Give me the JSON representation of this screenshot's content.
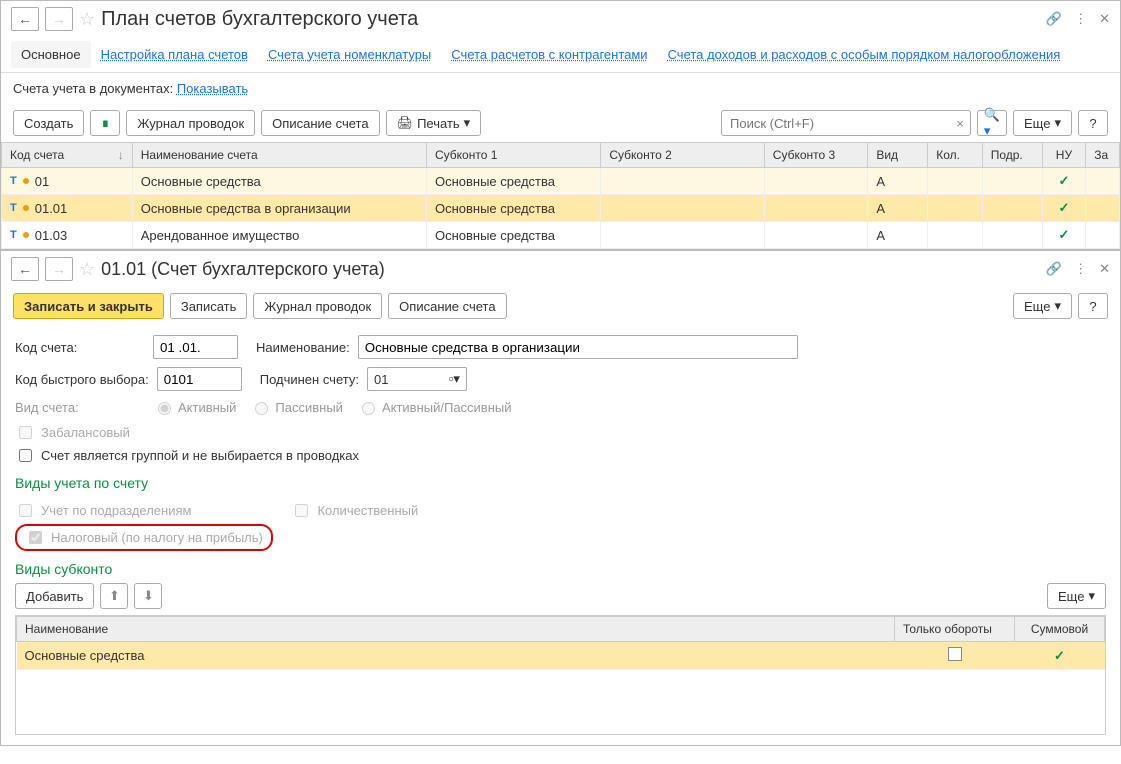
{
  "top": {
    "title": "План счетов бухгалтерского учета",
    "tabs": [
      "Основное",
      "Настройка плана счетов",
      "Счета учета номенклатуры",
      "Счета расчетов с контрагентами",
      "Счета доходов и расходов с особым порядком налогообложения"
    ],
    "subline_label": "Счета учета в документах:",
    "subline_link": "Показывать",
    "toolbar": {
      "create": "Создать",
      "journal": "Журнал проводок",
      "desc": "Описание счета",
      "print": "Печать",
      "more": "Еще",
      "help": "?",
      "search_placeholder": "Поиск (Ctrl+F)"
    },
    "cols": {
      "code": "Код счета",
      "name": "Наименование счета",
      "sub1": "Субконто 1",
      "sub2": "Субконто 2",
      "sub3": "Субконто 3",
      "vid": "Вид",
      "kol": "Кол.",
      "podr": "Подр.",
      "nu": "НУ",
      "za": "За"
    },
    "rows": [
      {
        "code": "01",
        "name": "Основные средства",
        "sub1": "Основные средства",
        "vid": "А",
        "nu": true
      },
      {
        "code": "01.01",
        "name": "Основные средства в организации",
        "sub1": "Основные средства",
        "vid": "А",
        "nu": true
      },
      {
        "code": "01.03",
        "name": "Арендованное имущество",
        "sub1": "Основные средства",
        "vid": "А",
        "nu": true
      }
    ]
  },
  "detail": {
    "title": "01.01 (Счет бухгалтерского учета)",
    "toolbar": {
      "save_close": "Записать и закрыть",
      "save": "Записать",
      "journal": "Журнал проводок",
      "desc": "Описание счета",
      "more": "Еще",
      "help": "?"
    },
    "fields": {
      "code_label": "Код счета:",
      "code_value": "01 .01.",
      "name_label": "Наименование:",
      "name_value": "Основные средства в организации",
      "fastcode_label": "Код быстрого выбора:",
      "fastcode_value": "0101",
      "parent_label": "Подчинен счету:",
      "parent_value": "01",
      "vid_label": "Вид счета:",
      "radio_active": "Активный",
      "radio_passive": "Пассивный",
      "radio_both": "Активный/Пассивный",
      "cb_offbalance": "Забалансовый",
      "cb_group": "Счет является группой и не выбирается в проводках"
    },
    "section1": {
      "title": "Виды учета по счету",
      "cb_podr": "Учет по подразделениям",
      "cb_qty": "Количественный",
      "cb_tax": "Налоговый (по налогу на прибыль)"
    },
    "section2": {
      "title": "Виды субконто",
      "add": "Добавить",
      "more": "Еще",
      "cols": {
        "name": "Наименование",
        "turnover": "Только обороты",
        "sum": "Суммовой"
      },
      "rows": [
        {
          "name": "Основные средства",
          "turnover": false,
          "sum": true
        }
      ]
    }
  }
}
